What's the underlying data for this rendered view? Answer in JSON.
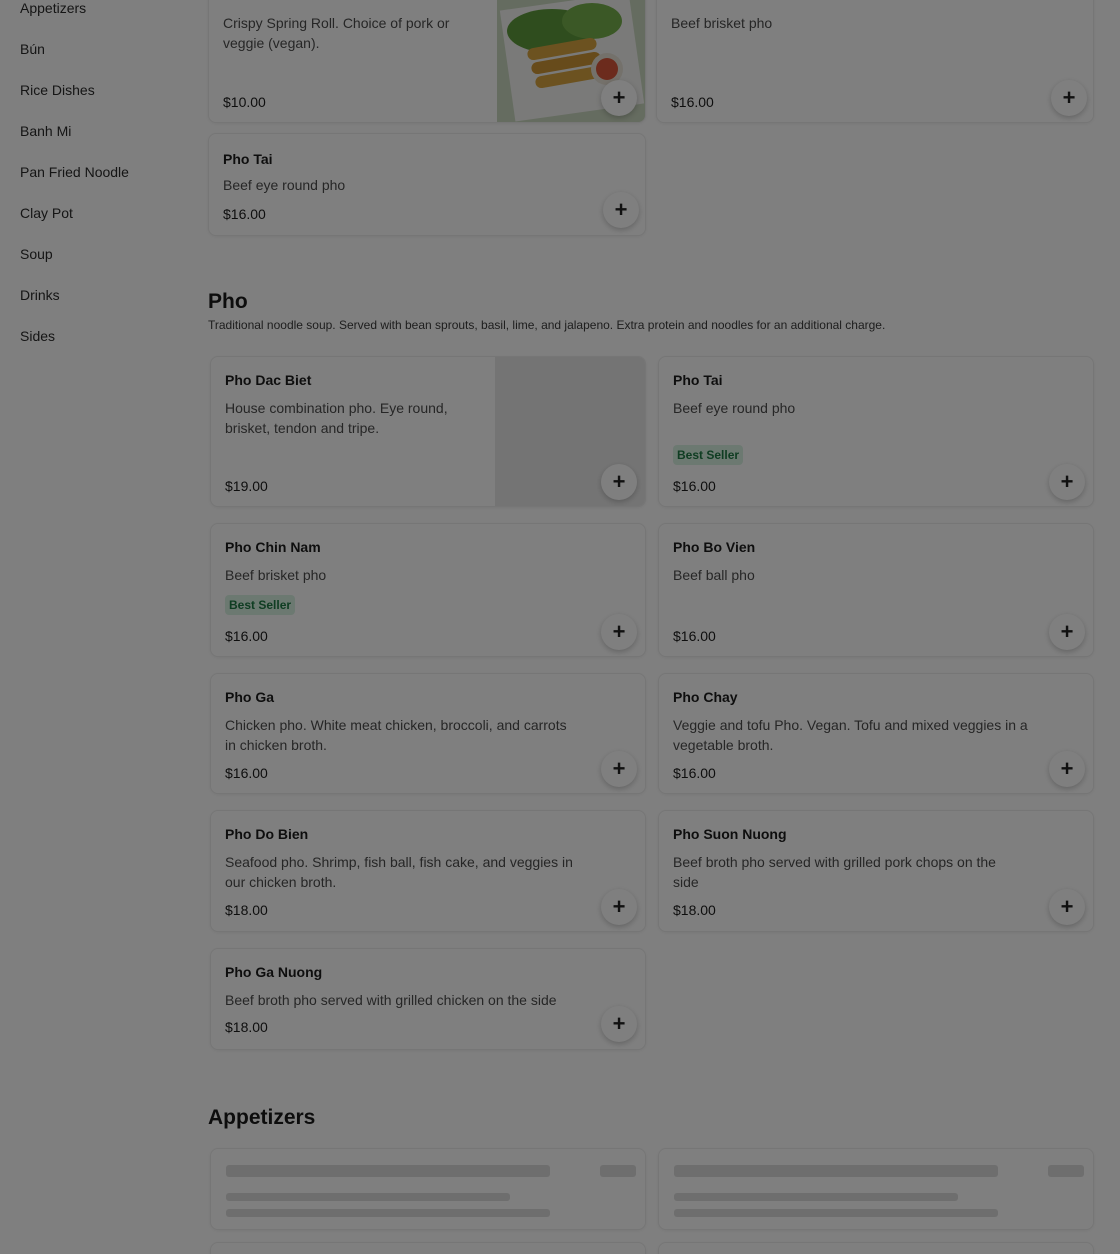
{
  "sidebar": {
    "items": [
      {
        "label": "Appetizers"
      },
      {
        "label": "Bún"
      },
      {
        "label": "Rice Dishes"
      },
      {
        "label": "Banh Mi"
      },
      {
        "label": "Pan Fried Noodle"
      },
      {
        "label": "Clay Pot"
      },
      {
        "label": "Soup"
      },
      {
        "label": "Drinks"
      },
      {
        "label": "Sides"
      }
    ]
  },
  "top_cards": [
    {
      "desc": "Crispy Spring Roll. Choice of pork or veggie (vegan).",
      "price": "$10.00"
    },
    {
      "desc": "Beef brisket pho",
      "price": "$16.00"
    },
    {
      "name": "Pho Tai",
      "desc": "Beef eye round pho",
      "price": "$16.00"
    }
  ],
  "pho_section": {
    "title": "Pho",
    "subtitle": "Traditional noodle soup. Served with bean sprouts, basil, lime, and jalapeno. Extra protein and noodles for an additional charge.",
    "items": [
      {
        "name": "Pho Dac Biet",
        "desc": "House combination pho. Eye round, brisket, tendon and tripe.",
        "price": "$19.00"
      },
      {
        "name": "Pho Tai",
        "desc": "Beef eye round pho",
        "badge": "Best Seller",
        "price": "$16.00"
      },
      {
        "name": "Pho Chin Nam",
        "desc": "Beef brisket pho",
        "badge": "Best Seller",
        "price": "$16.00"
      },
      {
        "name": "Pho Bo Vien",
        "desc": "Beef ball pho",
        "price": "$16.00"
      },
      {
        "name": "Pho Ga",
        "desc": "Chicken pho. White meat chicken, broccoli, and carrots in chicken broth.",
        "price": "$16.00"
      },
      {
        "name": "Pho Chay",
        "desc": "Veggie and tofu Pho. Vegan. Tofu and mixed veggies in a vegetable broth.",
        "price": "$16.00"
      },
      {
        "name": "Pho Do Bien",
        "desc": "Seafood pho. Shrimp, fish ball, fish cake, and veggies in our chicken broth.",
        "price": "$18.00"
      },
      {
        "name": "Pho Suon Nuong",
        "desc": "Beef broth pho served with grilled pork chops on the side",
        "price": "$18.00"
      },
      {
        "name": "Pho Ga Nuong",
        "desc": "Beef broth pho served with grilled chicken on the side",
        "price": "$18.00"
      }
    ]
  },
  "appetizers_section": {
    "title": "Appetizers"
  },
  "add_button": {
    "symbol": "+"
  },
  "colors": {
    "badge_bg": "#d9f2e2",
    "badge_text": "#1f7a45",
    "overlay": "rgba(0,0,0,0.5)"
  }
}
